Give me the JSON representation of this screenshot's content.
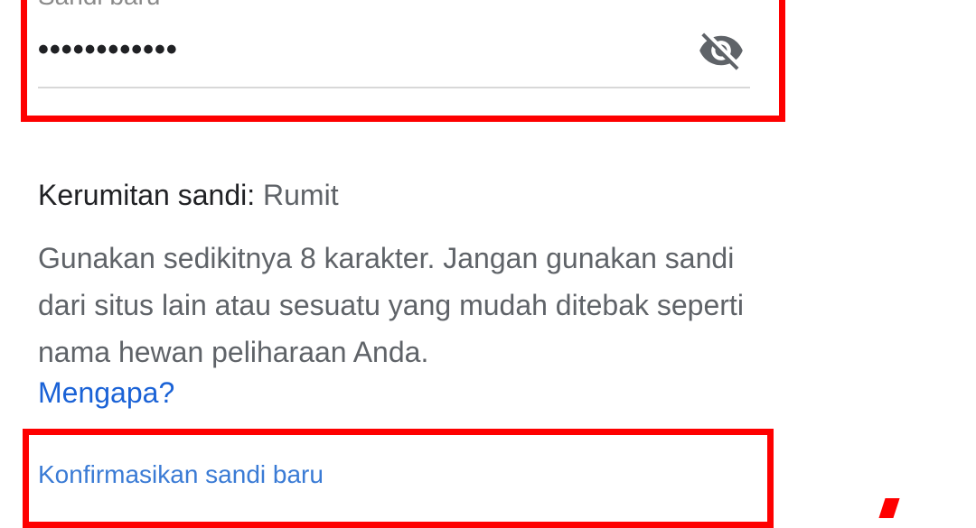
{
  "new_password": {
    "label": "Sandi baru",
    "value": "••••••••••••",
    "toggle_icon": "eye-off-icon"
  },
  "strength": {
    "label": "Kerumitan sandi:",
    "value": "Rumit"
  },
  "hint": {
    "text": "Gunakan sedikitnya 8 karakter. Jangan gunakan sandi dari situs lain atau sesuatu yang mudah ditebak seperti nama hewan peliharaan Anda.",
    "why_link": "Mengapa?"
  },
  "confirm_password": {
    "label": "Konfirmasikan sandi baru"
  },
  "colors": {
    "highlight": "#fe0000",
    "link": "#1a62d6",
    "focus_label": "#3a7bd5",
    "text_primary": "#202124",
    "text_secondary": "#5f6368"
  }
}
